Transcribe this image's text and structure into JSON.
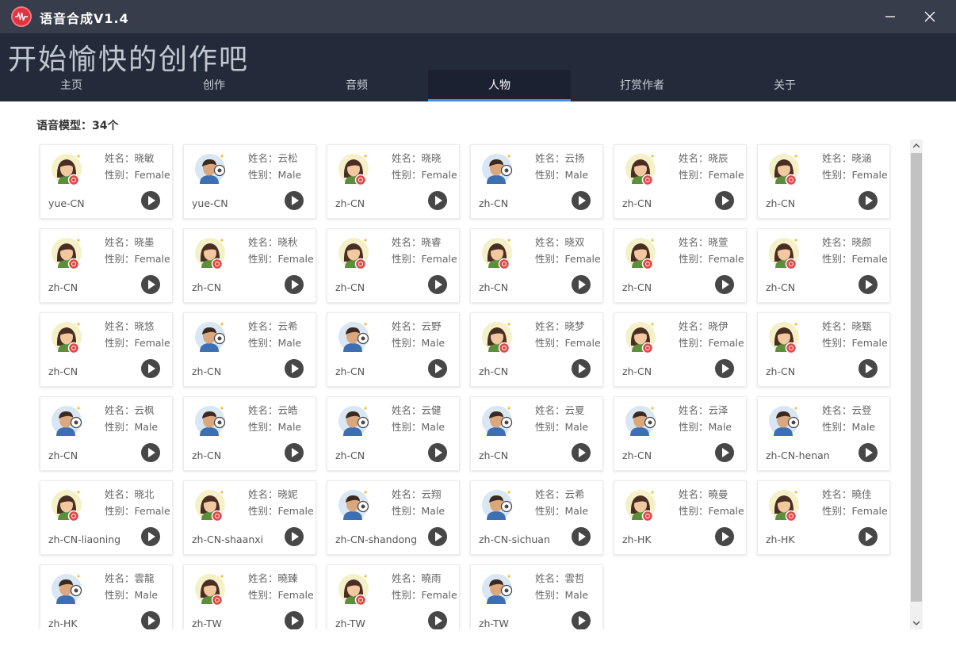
{
  "window": {
    "title": "语音合成V1.4"
  },
  "header": {
    "slogan": "开始愉快的创作吧"
  },
  "nav": {
    "tabs": [
      {
        "label": "主页",
        "active": false
      },
      {
        "label": "创作",
        "active": false
      },
      {
        "label": "音频",
        "active": false
      },
      {
        "label": "人物",
        "active": true
      },
      {
        "label": "打赏作者",
        "active": false
      },
      {
        "label": "关于",
        "active": false
      }
    ]
  },
  "content": {
    "count_label": "语音模型：34个"
  },
  "labels": {
    "name_prefix": "姓名：",
    "gender_prefix": "性别："
  },
  "icons": {
    "app_logo": "audio-wave-icon",
    "minimize": "minimize-icon",
    "close": "close-icon",
    "play": "play-icon",
    "female_avatar": "female-avatar-icon",
    "male_avatar": "male-avatar-icon"
  },
  "colors": {
    "accent": "#3d8ef0",
    "titlebar": "#373d4b",
    "header": "#232b3b",
    "logo": "#e3323f"
  },
  "voices": [
    {
      "name": "晓敏",
      "gender": "Female",
      "locale": "yue-CN"
    },
    {
      "name": "云松",
      "gender": "Male",
      "locale": "yue-CN"
    },
    {
      "name": "晓晓",
      "gender": "Female",
      "locale": "zh-CN"
    },
    {
      "name": "云扬",
      "gender": "Male",
      "locale": "zh-CN"
    },
    {
      "name": "晓辰",
      "gender": "Female",
      "locale": "zh-CN"
    },
    {
      "name": "晓涵",
      "gender": "Female",
      "locale": "zh-CN"
    },
    {
      "name": "晓墨",
      "gender": "Female",
      "locale": "zh-CN"
    },
    {
      "name": "晓秋",
      "gender": "Female",
      "locale": "zh-CN"
    },
    {
      "name": "晓睿",
      "gender": "Female",
      "locale": "zh-CN"
    },
    {
      "name": "晓双",
      "gender": "Female",
      "locale": "zh-CN"
    },
    {
      "name": "晓萱",
      "gender": "Female",
      "locale": "zh-CN"
    },
    {
      "name": "晓颜",
      "gender": "Female",
      "locale": "zh-CN"
    },
    {
      "name": "晓悠",
      "gender": "Female",
      "locale": "zh-CN"
    },
    {
      "name": "云希",
      "gender": "Male",
      "locale": "zh-CN"
    },
    {
      "name": "云野",
      "gender": "Male",
      "locale": "zh-CN"
    },
    {
      "name": "晓梦",
      "gender": "Female",
      "locale": "zh-CN"
    },
    {
      "name": "晓伊",
      "gender": "Female",
      "locale": "zh-CN"
    },
    {
      "name": "晓甄",
      "gender": "Female",
      "locale": "zh-CN"
    },
    {
      "name": "云枫",
      "gender": "Male",
      "locale": "zh-CN"
    },
    {
      "name": "云皓",
      "gender": "Male",
      "locale": "zh-CN"
    },
    {
      "name": "云健",
      "gender": "Male",
      "locale": "zh-CN"
    },
    {
      "name": "云夏",
      "gender": "Male",
      "locale": "zh-CN"
    },
    {
      "name": "云泽",
      "gender": "Male",
      "locale": "zh-CN"
    },
    {
      "name": "云登",
      "gender": "Male",
      "locale": "zh-CN-henan"
    },
    {
      "name": "晓北",
      "gender": "Female",
      "locale": "zh-CN-liaoning"
    },
    {
      "name": "晓妮",
      "gender": "Female",
      "locale": "zh-CN-shaanxi"
    },
    {
      "name": "云翔",
      "gender": "Male",
      "locale": "zh-CN-shandong"
    },
    {
      "name": "云希",
      "gender": "Male",
      "locale": "zh-CN-sichuan"
    },
    {
      "name": "曉曼",
      "gender": "Female",
      "locale": "zh-HK"
    },
    {
      "name": "曉佳",
      "gender": "Female",
      "locale": "zh-HK"
    },
    {
      "name": "雲龍",
      "gender": "Male",
      "locale": "zh-HK"
    },
    {
      "name": "曉臻",
      "gender": "Female",
      "locale": "zh-TW"
    },
    {
      "name": "曉雨",
      "gender": "Female",
      "locale": "zh-TW"
    },
    {
      "name": "雲哲",
      "gender": "Male",
      "locale": "zh-TW"
    }
  ]
}
